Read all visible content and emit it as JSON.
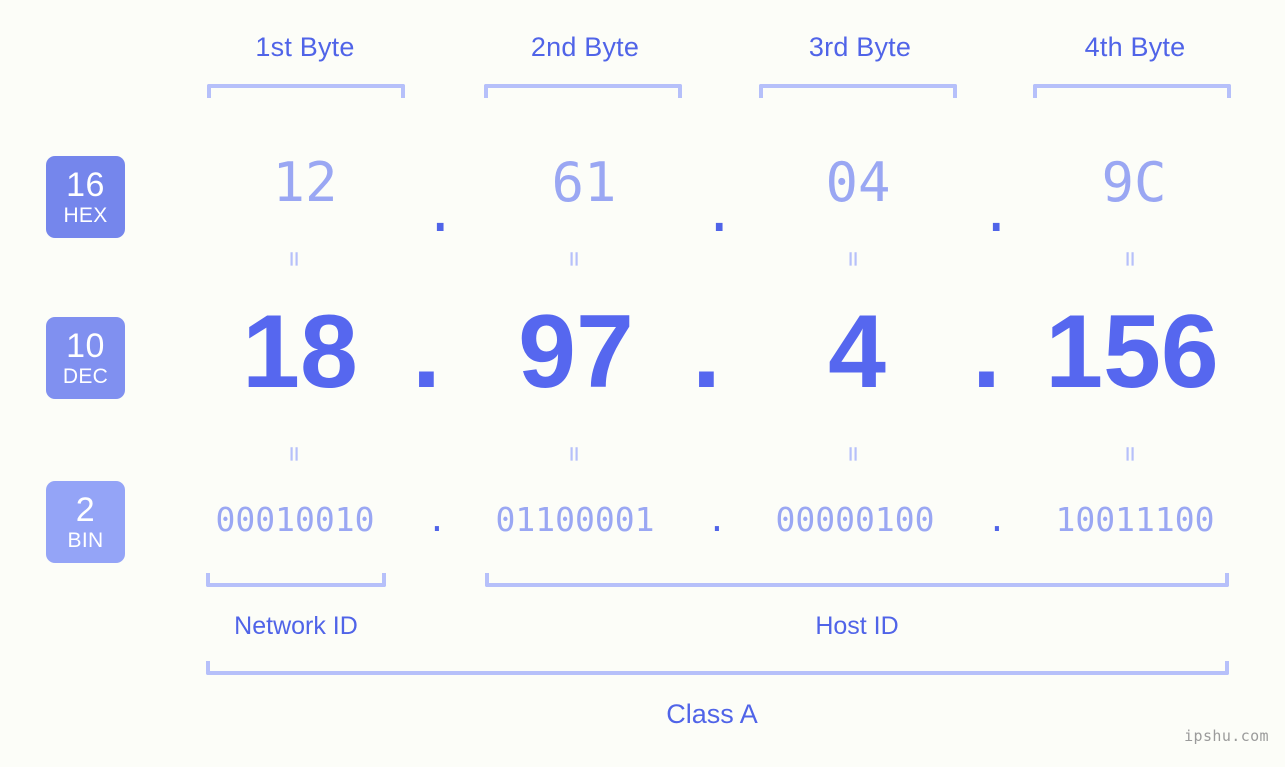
{
  "background": "#fcfdf8",
  "accent_strong": "#5064e8",
  "accent_mid": "#5667ef",
  "accent_light": "#9aa7f3",
  "bracket_color": "#b6c0fa",
  "byte_headers": [
    {
      "label": "1st Byte"
    },
    {
      "label": "2nd Byte"
    },
    {
      "label": "3rd Byte"
    },
    {
      "label": "4th Byte"
    }
  ],
  "bases": [
    {
      "num": "16",
      "abbr": "HEX",
      "color": "#7586ec"
    },
    {
      "num": "10",
      "abbr": "DEC",
      "color": "#8090f0"
    },
    {
      "num": "2",
      "abbr": "BIN",
      "color": "#94a4f7"
    }
  ],
  "separator": ".",
  "equals": "=",
  "rows": {
    "hex": {
      "values": [
        "12",
        "61",
        "04",
        "9C"
      ]
    },
    "dec": {
      "values": [
        "18",
        "97",
        "4",
        "156"
      ]
    },
    "bin": {
      "values": [
        "00010010",
        "01100001",
        "00000100",
        "10011100"
      ]
    }
  },
  "id_labels": {
    "network": "Network ID",
    "host": "Host ID"
  },
  "class_label": "Class A",
  "watermark": "ipshu.com",
  "chart_data": {
    "type": "table",
    "title": "IP address byte breakdown",
    "columns": [
      "1st Byte",
      "2nd Byte",
      "3rd Byte",
      "4th Byte"
    ],
    "rows": [
      {
        "base": "HEX",
        "radix": 16,
        "values": [
          "12",
          "61",
          "04",
          "9C"
        ]
      },
      {
        "base": "DEC",
        "radix": 10,
        "values": [
          "18",
          "97",
          "4",
          "156"
        ]
      },
      {
        "base": "BIN",
        "radix": 2,
        "values": [
          "00010010",
          "01100001",
          "00000100",
          "10011100"
        ]
      }
    ],
    "annotations": [
      "Network ID",
      "Host ID",
      "Class A"
    ],
    "network_id_bytes": 1,
    "host_id_bytes": 3
  }
}
